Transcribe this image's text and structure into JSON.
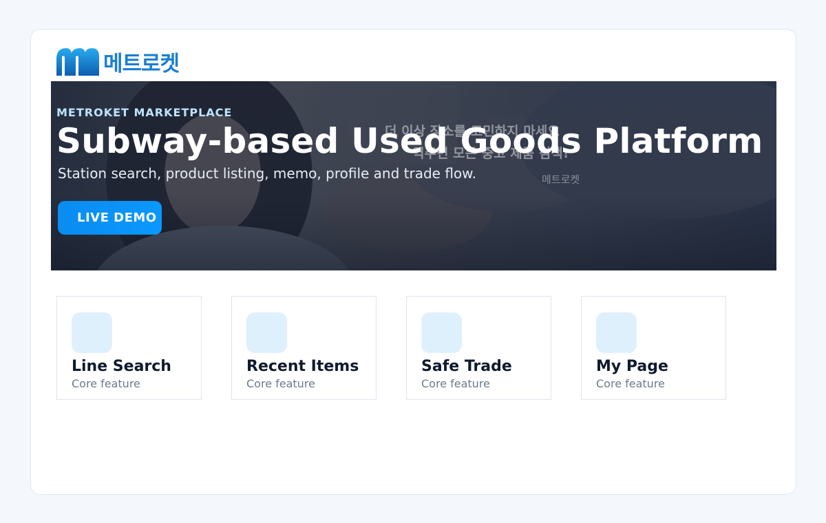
{
  "brand": {
    "logo_icon": "metro-rocket-logo-icon",
    "logo_text": "메트로켓"
  },
  "hero": {
    "eyebrow": "METROKET MARKETPLACE",
    "title": "Subway-based Used Goods Platform",
    "subtitle": "Station search, product listing, memo, profile and trade flow.",
    "cta_label": "LIVE DEMO",
    "background_copy_line1": "더 이상 장소를 고민하지 마세요",
    "background_copy_line2": "역주변 모든 중고 제품 검색!",
    "background_brand": "메트로켓"
  },
  "features": [
    {
      "icon": "feature-icon",
      "title": "Line Search",
      "subtitle": "Core feature"
    },
    {
      "icon": "feature-icon",
      "title": "Recent Items",
      "subtitle": "Core feature"
    },
    {
      "icon": "feature-icon",
      "title": "Safe Trade",
      "subtitle": "Core feature"
    },
    {
      "icon": "feature-icon",
      "title": "My Page",
      "subtitle": "Core feature"
    }
  ],
  "colors": {
    "accent": "#0a98ff",
    "brand_blue": "#1a7fd1",
    "eyebrow": "#bfe3ff",
    "feature_icon_bg": "#dff0fd",
    "page_bg": "#f4f8fd"
  }
}
